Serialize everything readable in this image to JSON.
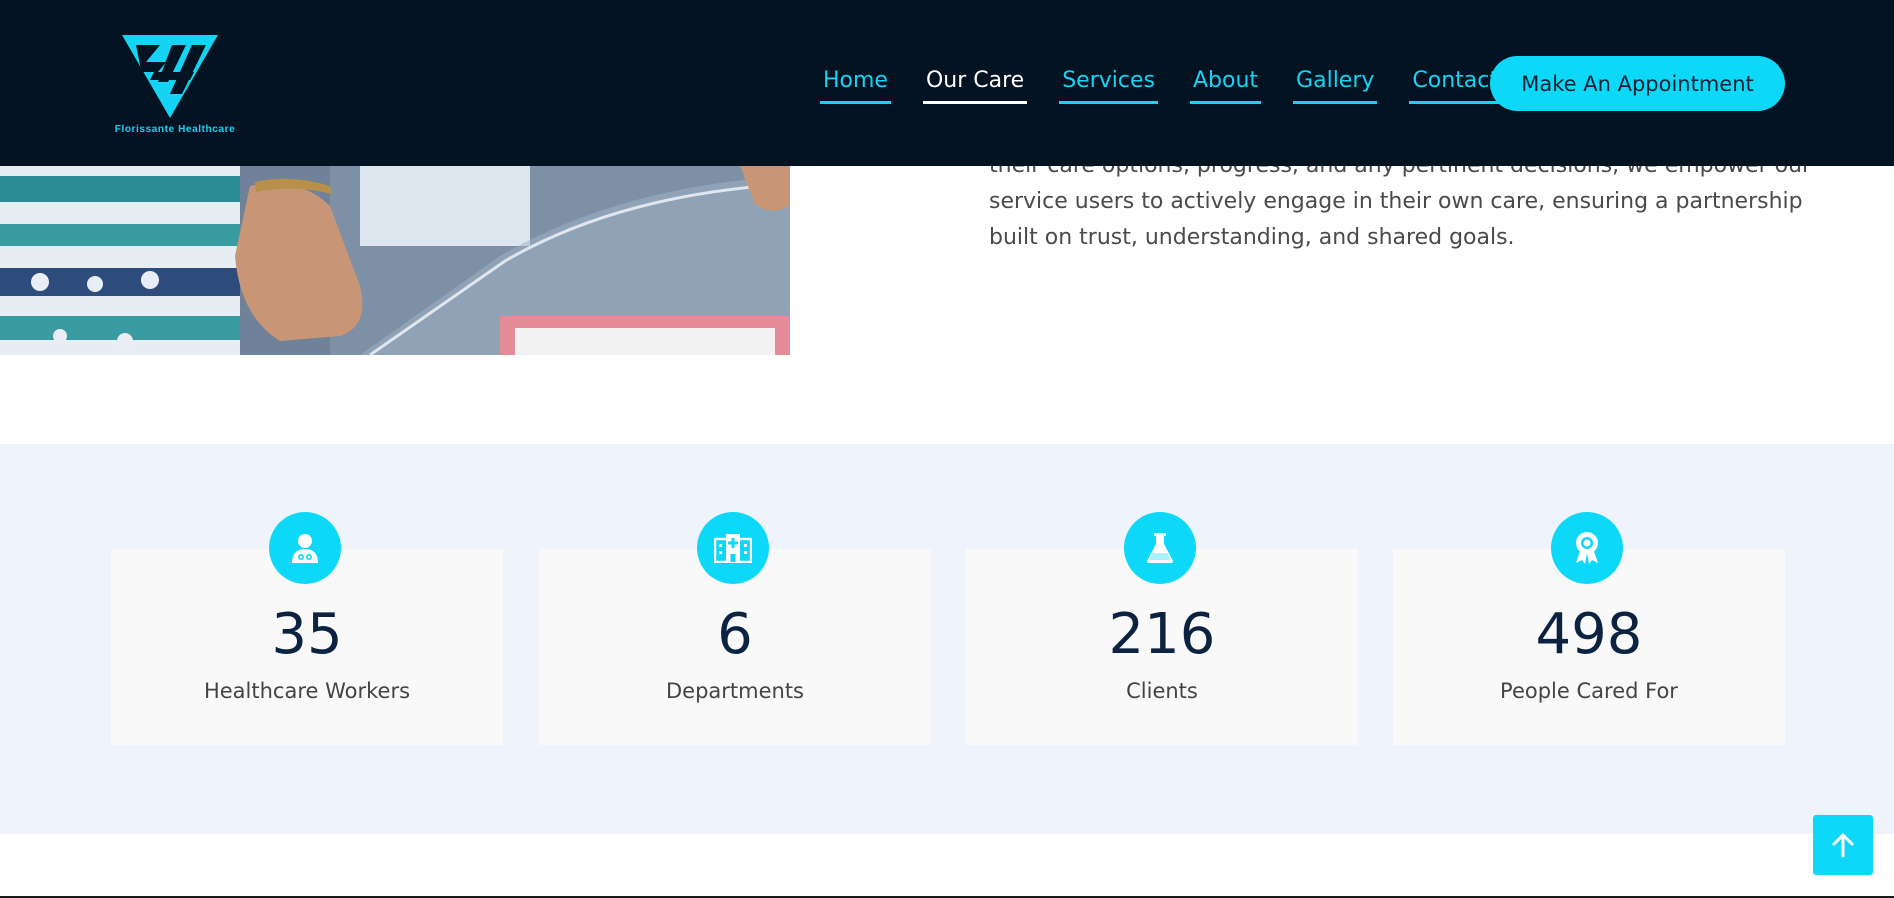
{
  "header": {
    "logo_text": "Florissante Healthcare",
    "nav": [
      {
        "label": "Home"
      },
      {
        "label": "Our Care"
      },
      {
        "label": "Services"
      },
      {
        "label": "About"
      },
      {
        "label": "Gallery"
      },
      {
        "label": "Contact"
      }
    ],
    "active_nav": "Our Care",
    "cta_label": "Make An Appointment"
  },
  "intro": {
    "paragraph": "their care options, progress, and any pertinent decisions, we empower our service users to actively engage in their own care, ensuring a partnership built on trust, understanding, and shared goals."
  },
  "stats": [
    {
      "icon": "doctor-icon",
      "value": "35",
      "label": "Healthcare Workers"
    },
    {
      "icon": "hospital-icon",
      "value": "6",
      "label": "Departments"
    },
    {
      "icon": "flask-icon",
      "value": "216",
      "label": "Clients"
    },
    {
      "icon": "award-icon",
      "value": "498",
      "label": "People Cared For"
    }
  ],
  "back_to_top": {
    "icon": "arrow-up-icon"
  },
  "colors": {
    "header_bg": "#031321",
    "accent": "#0ed8f7",
    "stats_bg": "#eff4fc",
    "number_color": "#0b2340"
  }
}
